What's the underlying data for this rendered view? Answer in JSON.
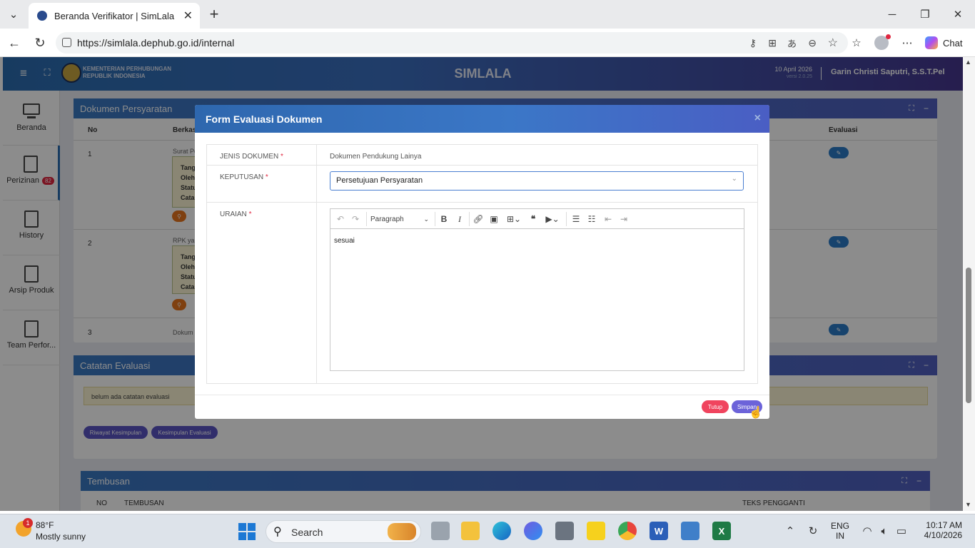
{
  "browser": {
    "tab_title": "Beranda Verifikator | SimLala",
    "url": "https://simlala.dephub.go.id/internal",
    "copilot_label": "Chat"
  },
  "app": {
    "ministry_line1": "KEMENTERIAN PERHUBUNGAN",
    "ministry_line2": "REPUBLIK INDONESIA",
    "title": "SIMLALA",
    "date": "10 April 2026",
    "version": "versi 2.0.25",
    "user": "Garin Christi Saputri, S.S.T.Pel"
  },
  "sidebar": {
    "items": [
      {
        "label": "Beranda",
        "icon": "monitor-icon"
      },
      {
        "label": "Perizinan",
        "icon": "document-icon",
        "badge": "82"
      },
      {
        "label": "History",
        "icon": "document-icon"
      },
      {
        "label": "Arsip Produk",
        "icon": "document-icon"
      },
      {
        "label": "Team Perfor...",
        "icon": "document-icon"
      }
    ]
  },
  "dokumen": {
    "title": "Dokumen Persyaratan",
    "col_no": "No",
    "col_berkas": "Berkas",
    "col_evaluasi": "Evaluasi",
    "rows": [
      {
        "no": "1",
        "berkas": "Surat Pe",
        "lines": [
          "Tang",
          "Oleh",
          "Statu",
          "Cata"
        ]
      },
      {
        "no": "2",
        "berkas": "RPK yar",
        "lines": [
          "Tang",
          "Oleh",
          "Statu",
          "Cata"
        ]
      },
      {
        "no": "3",
        "berkas": "Dokum"
      }
    ]
  },
  "catatan": {
    "title": "Catatan Evaluasi",
    "empty_text": "belum ada catatan evaluasi",
    "btn_riwayat": "Riwayat Kesimpulan",
    "btn_kesimpulan": "Kesimpulan Evaluasi"
  },
  "tembusan": {
    "title": "Tembusan",
    "col_no": "NO",
    "col_tembusan": "TEMBUSAN",
    "col_teks": "TEKS PENGGANTI"
  },
  "modal": {
    "title": "Form Evaluasi Dokumen",
    "close": "×",
    "jenis_label": "JENIS DOKUMEN",
    "jenis_value": "Dokumen Pendukung Lainya",
    "keputusan_label": "KEPUTUSAN",
    "keputusan_value": "Persetujuan Persyaratan",
    "uraian_label": "URAIAN",
    "required_mark": "*",
    "editor_format": "Paragraph",
    "editor_text": "sesuai",
    "btn_tutup": "Tutup",
    "btn_simpan": "Simpan"
  },
  "taskbar": {
    "weather_temp": "88°F",
    "weather_desc": "Mostly sunny",
    "weather_badge": "1",
    "search_placeholder": "Search",
    "lang_line1": "ENG",
    "lang_line2": "IN",
    "time": "10:17 AM",
    "date": "4/10/2026"
  },
  "colors": {
    "header_blue": "#2b6cb0",
    "header_purple": "#45378f",
    "btn_red": "#f0445e",
    "btn_purple": "#6c63d9",
    "orange": "#e8761e"
  }
}
